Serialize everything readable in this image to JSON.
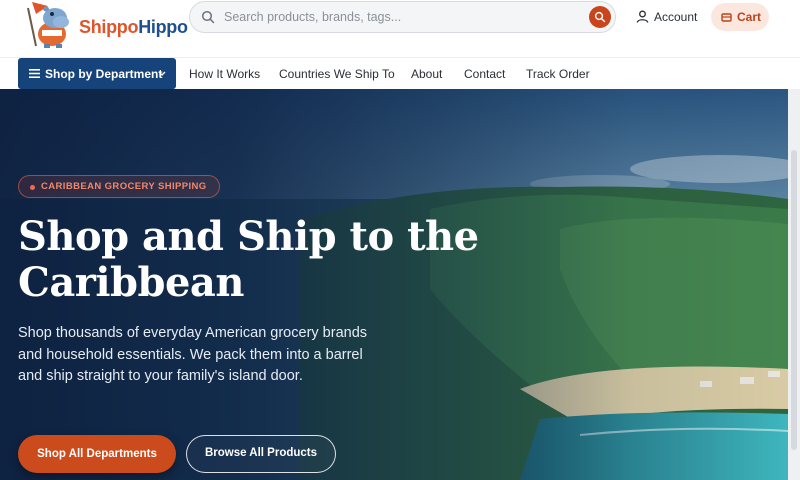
{
  "brand": {
    "name_part1": "Shippo",
    "name_part2": "Hippo"
  },
  "search": {
    "placeholder": "Search products, brands, tags..."
  },
  "header": {
    "account_label": "Account",
    "cart_label": "Cart"
  },
  "nav": {
    "department_button": "Shop by Department",
    "links": [
      "How It Works",
      "Countries We Ship To",
      "About",
      "Contact",
      "Track Order"
    ]
  },
  "hero": {
    "badge": "CARIBBEAN GROCERY SHIPPING",
    "title_line1": "Shop and Ship to the",
    "title_line2": "Caribbean",
    "description": "Shop thousands of everyday American grocery brands and household essentials. We pack them into a barrel and ship straight to your family's island door.",
    "primary_button": "Shop All Departments",
    "secondary_button": "Browse All Products"
  },
  "colors": {
    "accent": "#cc4b1d",
    "brand_blue": "#16437a",
    "cart_bg": "#fbe7de"
  },
  "icons": {
    "search": "search-icon",
    "account": "user-icon",
    "cart": "cart-icon",
    "menu": "menu-icon",
    "chevron": "chevron-down-icon"
  }
}
